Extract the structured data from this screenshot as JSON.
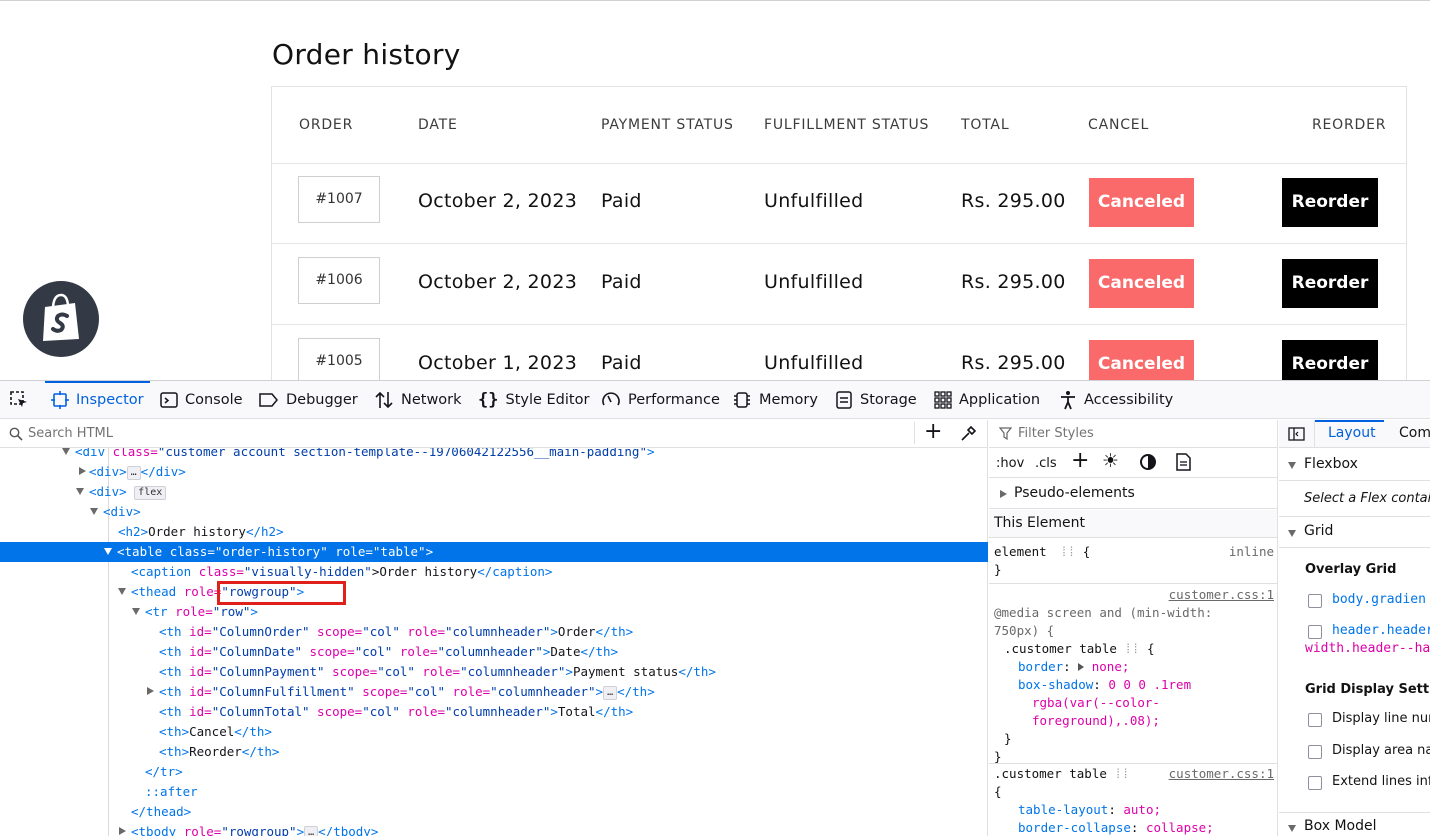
{
  "page": {
    "title": "Order history",
    "columns": [
      "ORDER",
      "DATE",
      "PAYMENT STATUS",
      "FULFILLMENT STATUS",
      "TOTAL",
      "CANCEL",
      "REORDER"
    ],
    "orders": [
      {
        "id": "#1007",
        "date": "October 2, 2023",
        "payment": "Paid",
        "fulfillment": "Unfulfilled",
        "total": "Rs. 295.00",
        "cancel": "Canceled",
        "reorder": "Reorder"
      },
      {
        "id": "#1006",
        "date": "October 2, 2023",
        "payment": "Paid",
        "fulfillment": "Unfulfilled",
        "total": "Rs. 295.00",
        "cancel": "Canceled",
        "reorder": "Reorder"
      },
      {
        "id": "#1005",
        "date": "October 1, 2023",
        "payment": "Paid",
        "fulfillment": "Unfulfilled",
        "total": "Rs. 295.00",
        "cancel": "Canceled",
        "reorder": "Reorder"
      }
    ],
    "colors": {
      "cancel_bg": "#fa6a6a",
      "reorder_bg": "#000000",
      "shopify_badge": "#333a45"
    }
  },
  "devtools": {
    "tabs": [
      "Inspector",
      "Console",
      "Debugger",
      "Network",
      "Style Editor",
      "Performance",
      "Memory",
      "Storage",
      "Application",
      "Accessibility"
    ],
    "active_tab": "Inspector",
    "search_placeholder": "Search HTML",
    "tree": {
      "l0_a": "<div ",
      "l0_b": "class=",
      "l0_c": "\"customer account section-template--19706042122556__main-padding\"",
      "l0_d": ">",
      "l1_a": "<div>",
      "l1_badge": "…",
      "l1_b": "</div>",
      "l2_a": "<div>",
      "l2_badge": "flex",
      "l3_a": "<div>",
      "l4_a": "<h2>",
      "l4_b": "Order history",
      "l4_c": "</h2>",
      "l5_a": "<table ",
      "l5_b": "class=",
      "l5_c": "\"order-history\"",
      "l5_d": " role=",
      "l5_e": "\"table\"",
      "l5_f": ">",
      "l6_a": "<caption ",
      "l6_b": "class=",
      "l6_c": "\"visually-hidden\"",
      "l6_d": ">Order history",
      "l6_e": "</caption>",
      "l7_a": "<thead ",
      "l7_b": "role=",
      "l7_c": "\"rowgroup\"",
      "l7_d": ">",
      "l8_a": "<tr ",
      "l8_b": "role=",
      "l8_c": "\"row\"",
      "l8_d": ">",
      "l9": {
        "id": "\"ColumnOrder\"",
        "text": "Order"
      },
      "l10": {
        "id": "\"ColumnDate\"",
        "text": "Date"
      },
      "l11": {
        "id": "\"ColumnPayment\"",
        "text": "Payment status"
      },
      "l12": {
        "id": "\"ColumnFulfillment\"",
        "badge": "…"
      },
      "l13": {
        "id": "\"ColumnTotal\"",
        "text": "Total"
      },
      "th_open": "<th ",
      "th_id": "id=",
      "th_scope": " scope=",
      "th_col": "\"col\"",
      "th_role": " role=",
      "th_colhdr": "\"columnheader\"",
      "th_close": "</th>",
      "gt": ">",
      "l14_a": "<th>",
      "l14_b": "Cancel",
      "l14_c": "</th>",
      "l15_a": "<th>",
      "l15_b": "Reorder",
      "l15_c": "</th>",
      "l16": "</tr>",
      "l17": "::after",
      "l18": "</thead>",
      "l19_a": "<tbody ",
      "l19_b": "role=",
      "l19_c": "\"rowgroup\"",
      "l19_d": ">",
      "l19_badge": "…",
      "l19_e": "</tbody>"
    },
    "rules": {
      "filter_placeholder": "Filter Styles",
      "hov": ":hov",
      "cls": ".cls",
      "pseudo": "Pseudo-elements",
      "this_element": "This Element",
      "element_sel": "element",
      "element_brace": "{",
      "element_close": "}",
      "inline": "inline",
      "r1_source": "customer.css:1",
      "r1_media": "@media screen and (min-width:",
      "r1_media2": "750px) {",
      "r1_sel": ".customer table",
      "r1_border_prop": "border",
      "r1_border_val": "none;",
      "r1_shadow_prop": "box-shadow",
      "r1_shadow_val": "0 0 0 .1rem",
      "r1_shadow_val2": "rgba(var(--color-",
      "r1_shadow_val3": "foreground),.08);",
      "r2_source": "customer.css:1",
      "r2_sel": ".customer table",
      "r2_layout_prop": "table-layout",
      "r2_layout_val": "auto;",
      "r2_collapse_prop": "border-collapse",
      "r2_collapse_val": "collapse;"
    },
    "layout": {
      "tabs": [
        "Layout",
        "Com"
      ],
      "flexbox": "Flexbox",
      "flex_hint": "Select a Flex contai",
      "grid": "Grid",
      "overlay_grid": "Overlay Grid",
      "overlay_items": [
        "body.gradien",
        "header.header"
      ],
      "overlay_item2_cont": "width.header--ha",
      "grid_display": "Grid Display Setting",
      "display_items": [
        "Display line num",
        "Display area nar",
        "Extend lines infir"
      ],
      "box_model": "Box Model"
    }
  }
}
